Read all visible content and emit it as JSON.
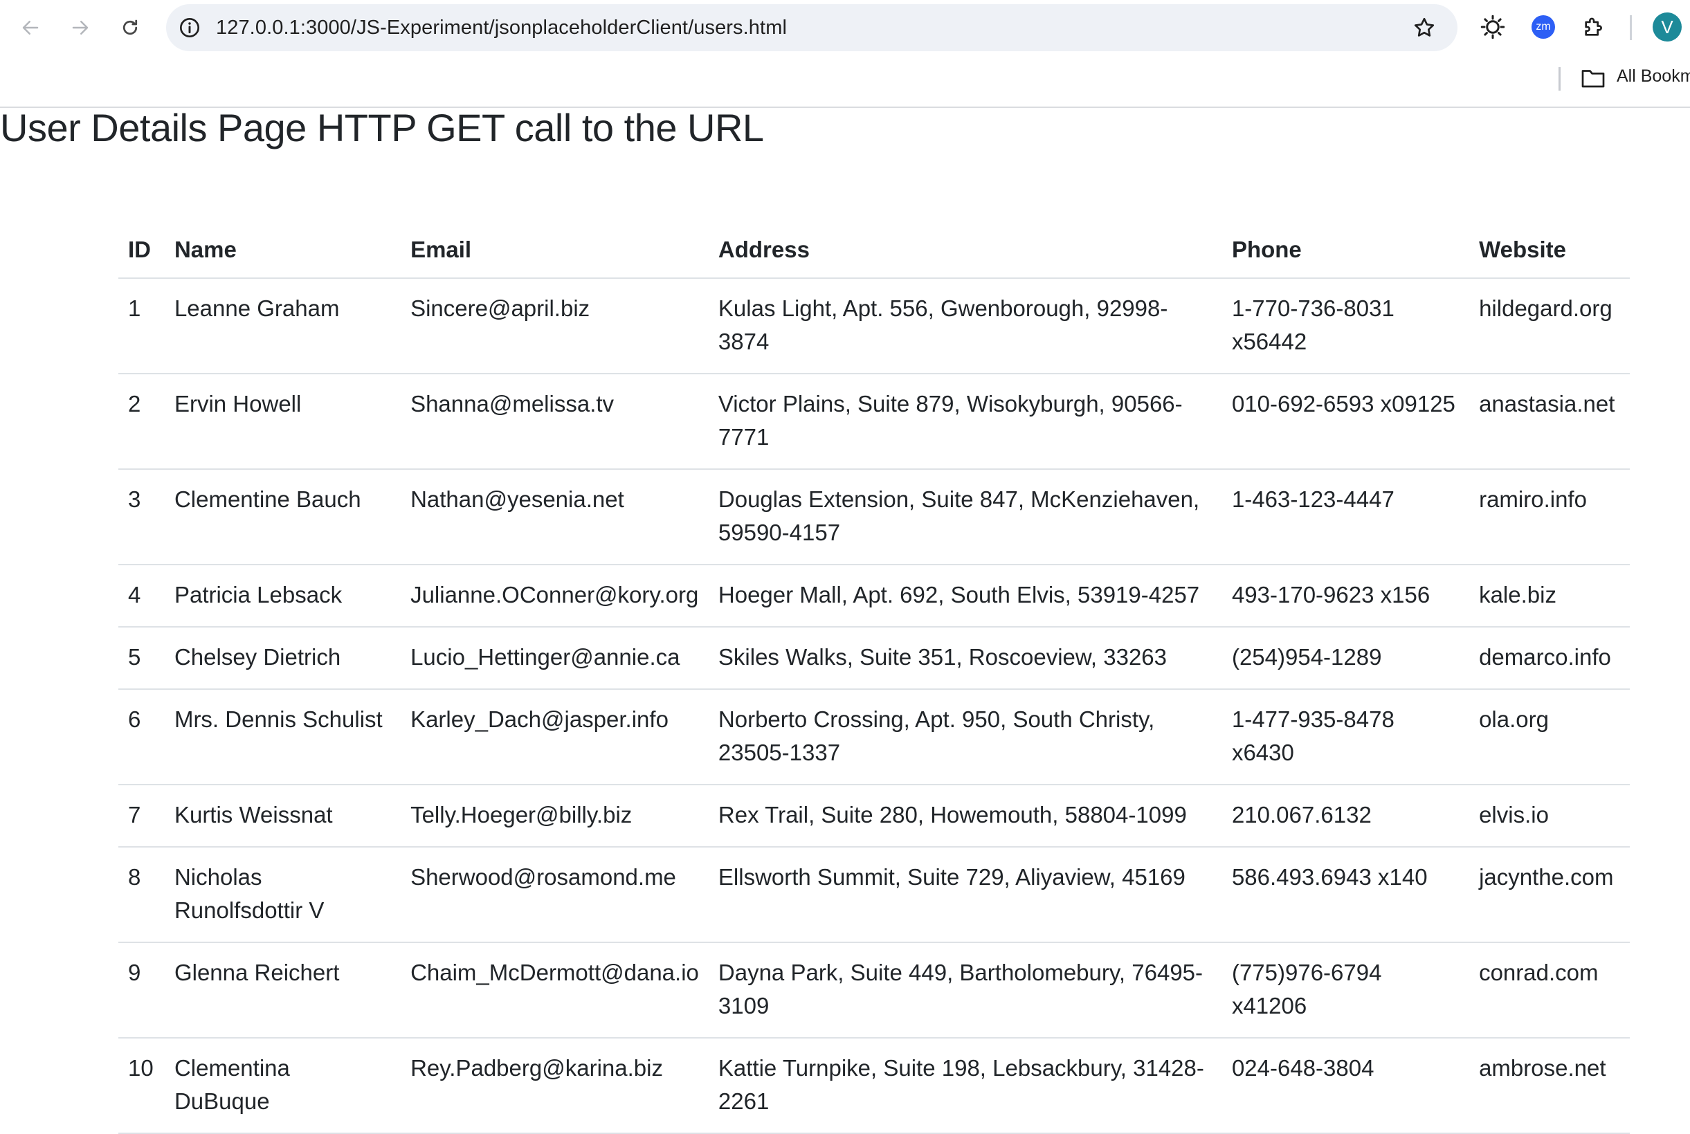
{
  "browser": {
    "url": "127.0.0.1:3000/JS-Experiment/jsonplaceholderClient/users.html",
    "extension_zoom_label": "zm",
    "profile_initial": "V",
    "bookmarks_label": "All Bookm",
    "accent_color": "#1d8a99"
  },
  "page": {
    "title": "User Details Page HTTP GET call to the URL"
  },
  "table": {
    "headers": [
      "ID",
      "Name",
      "Email",
      "Address",
      "Phone",
      "Website"
    ],
    "rows": [
      {
        "id": "1",
        "name": "Leanne Graham",
        "email": "Sincere@april.biz",
        "address": "Kulas Light, Apt. 556, Gwenborough, 92998-3874",
        "phone": "1-770-736-8031 x56442",
        "website": "hildegard.org"
      },
      {
        "id": "2",
        "name": "Ervin Howell",
        "email": "Shanna@melissa.tv",
        "address": "Victor Plains, Suite 879, Wisokyburgh, 90566-7771",
        "phone": "010-692-6593 x09125",
        "website": "anastasia.net"
      },
      {
        "id": "3",
        "name": "Clementine Bauch",
        "email": "Nathan@yesenia.net",
        "address": "Douglas Extension, Suite 847, McKenziehaven, 59590-4157",
        "phone": "1-463-123-4447",
        "website": "ramiro.info"
      },
      {
        "id": "4",
        "name": "Patricia Lebsack",
        "email": "Julianne.OConner@kory.org",
        "address": "Hoeger Mall, Apt. 692, South Elvis, 53919-4257",
        "phone": "493-170-9623 x156",
        "website": "kale.biz"
      },
      {
        "id": "5",
        "name": "Chelsey Dietrich",
        "email": "Lucio_Hettinger@annie.ca",
        "address": "Skiles Walks, Suite 351, Roscoeview, 33263",
        "phone": "(254)954-1289",
        "website": "demarco.info"
      },
      {
        "id": "6",
        "name": "Mrs. Dennis Schulist",
        "email": "Karley_Dach@jasper.info",
        "address": "Norberto Crossing, Apt. 950, South Christy, 23505-1337",
        "phone": "1-477-935-8478 x6430",
        "website": "ola.org"
      },
      {
        "id": "7",
        "name": "Kurtis Weissnat",
        "email": "Telly.Hoeger@billy.biz",
        "address": "Rex Trail, Suite 280, Howemouth, 58804-1099",
        "phone": "210.067.6132",
        "website": "elvis.io"
      },
      {
        "id": "8",
        "name": "Nicholas Runolfsdottir V",
        "email": "Sherwood@rosamond.me",
        "address": "Ellsworth Summit, Suite 729, Aliyaview, 45169",
        "phone": "586.493.6943 x140",
        "website": "jacynthe.com"
      },
      {
        "id": "9",
        "name": "Glenna Reichert",
        "email": "Chaim_McDermott@dana.io",
        "address": "Dayna Park, Suite 449, Bartholomebury, 76495-3109",
        "phone": "(775)976-6794 x41206",
        "website": "conrad.com"
      },
      {
        "id": "10",
        "name": "Clementina DuBuque",
        "email": "Rey.Padberg@karina.biz",
        "address": "Kattie Turnpike, Suite 198, Lebsackbury, 31428-2261",
        "phone": "024-648-3804",
        "website": "ambrose.net"
      }
    ]
  }
}
